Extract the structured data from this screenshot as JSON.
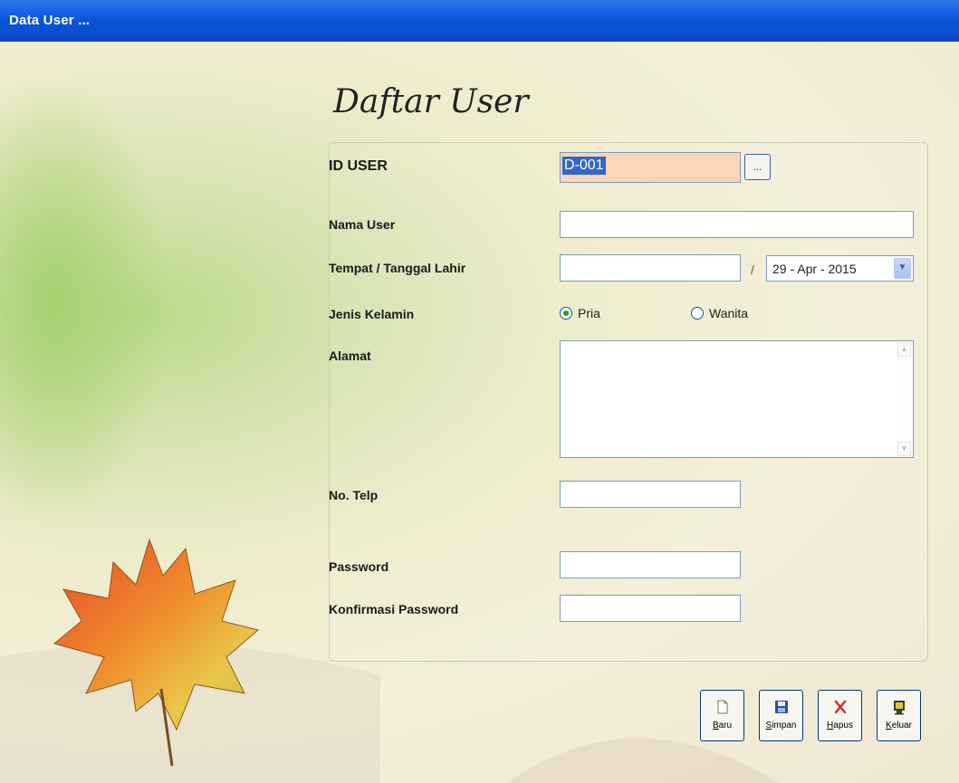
{
  "window": {
    "title": "Data User ..."
  },
  "form": {
    "heading": "Daftar User",
    "id_user": {
      "label": "ID USER",
      "value": "D-001",
      "browse_label": "..."
    },
    "nama_user": {
      "label": "Nama User",
      "value": ""
    },
    "tempat_tanggal_lahir": {
      "label": "Tempat / Tanggal Lahir",
      "tempat_value": "",
      "separator": "/",
      "tanggal_value": "29 - Apr - 2015"
    },
    "jenis_kelamin": {
      "label": "Jenis Kelamin",
      "options": [
        "Pria",
        "Wanita"
      ],
      "selected": "Pria"
    },
    "alamat": {
      "label": "Alamat",
      "value": ""
    },
    "no_telp": {
      "label": "No. Telp",
      "value": ""
    },
    "password": {
      "label": "Password",
      "value": ""
    },
    "konfirmasi_password": {
      "label": "Konfirmasi Password",
      "value": ""
    }
  },
  "toolbar": {
    "baru": {
      "hotkey": "B",
      "rest": "aru",
      "icon": "new-document-icon"
    },
    "simpan": {
      "hotkey": "S",
      "rest": "impan",
      "icon": "floppy-disk-icon"
    },
    "hapus": {
      "hotkey": "H",
      "rest": "apus",
      "icon": "delete-x-icon"
    },
    "keluar": {
      "hotkey": "K",
      "rest": "eluar",
      "icon": "exit-door-icon"
    }
  },
  "colors": {
    "titlebar": "#0a56d8",
    "id_field_bg": "#fad7b8",
    "selection": "#3168c5",
    "radio_dot": "#21a121"
  }
}
